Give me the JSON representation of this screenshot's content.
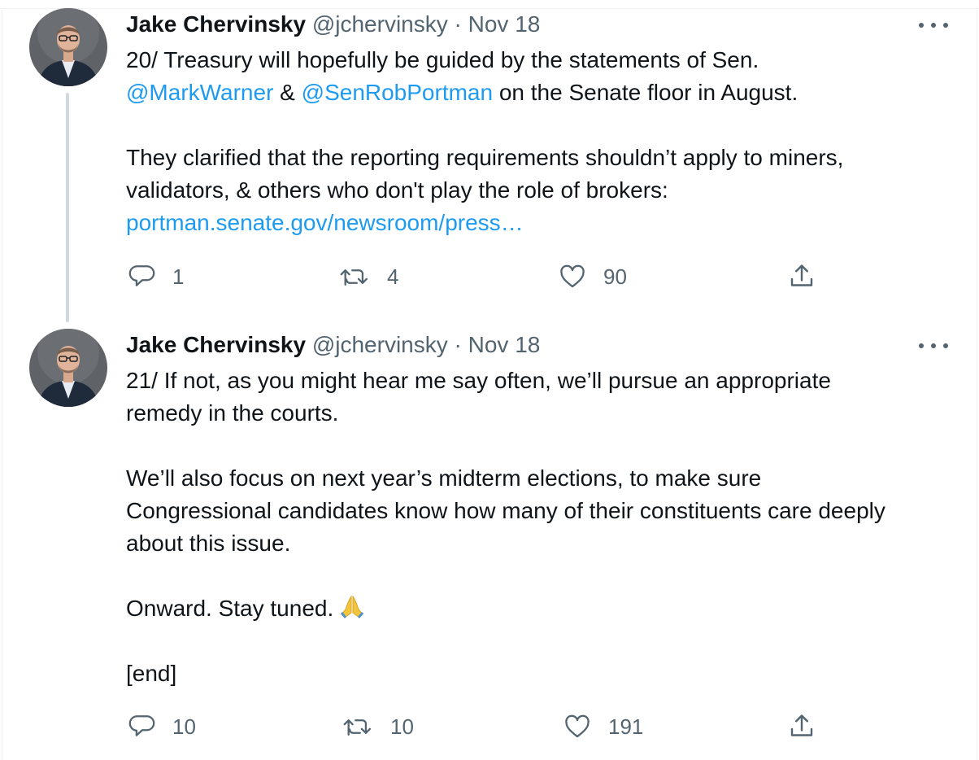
{
  "colors": {
    "link": "#1d9bf0",
    "secondary": "#536471",
    "text": "#0f1419",
    "thread_line": "#cfd9de"
  },
  "tweets": [
    {
      "author": "Jake Chervinsky",
      "handle": "@jchervinsky",
      "separator": "·",
      "date": "Nov 18",
      "line1": "20/ Treasury will hopefully be guided by the statements of Sen.",
      "mention1": "@MarkWarner",
      "amp": " & ",
      "mention2": "@SenRobPortman",
      "line2_tail": " on the Senate floor in August.",
      "line3": "They clarified that the reporting requirements shouldn’t apply to miners,",
      "line4": "validators, & others who don't play the role of brokers:",
      "link": "portman.senate.gov/newsroom/press…",
      "replies": "1",
      "retweets": "4",
      "likes": "90",
      "more_icon": "more-icon",
      "reply_icon": "reply-icon",
      "retweet_icon": "retweet-icon",
      "like_icon": "heart-icon",
      "share_icon": "share-icon"
    },
    {
      "author": "Jake Chervinsky",
      "handle": "@jchervinsky",
      "separator": "·",
      "date": "Nov 18",
      "line1": "21/ If not, as you might hear me say often, we’ll pursue an appropriate",
      "line2": "remedy in the courts.",
      "line3": "We’ll also focus on next year’s midterm elections, to make sure",
      "line4": "Congressional candidates know how many of their constituents care deeply",
      "line5": "about this issue.",
      "line6": "Onward. Stay tuned.",
      "emoji": "🙏",
      "line7": "[end]",
      "replies": "10",
      "retweets": "10",
      "likes": "191",
      "more_icon": "more-icon",
      "reply_icon": "reply-icon",
      "retweet_icon": "retweet-icon",
      "like_icon": "heart-icon",
      "share_icon": "share-icon"
    }
  ]
}
